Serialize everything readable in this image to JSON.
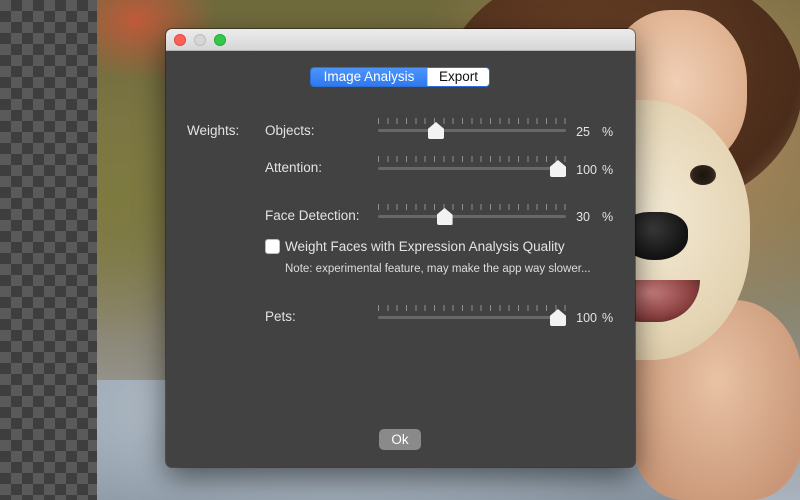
{
  "window": {
    "tabs": [
      {
        "label": "Image Analysis",
        "active": true
      },
      {
        "label": "Export",
        "active": false
      }
    ],
    "weights_label": "Weights:",
    "sliders": {
      "objects": {
        "label": "Objects:",
        "value": "25",
        "unit": "%",
        "level": 0.25
      },
      "attention": {
        "label": "Attention:",
        "value": "100",
        "unit": "%",
        "level": 1.0
      },
      "face_detection": {
        "label": "Face Detection:",
        "value": "30",
        "unit": "%",
        "level": 0.3
      },
      "pets": {
        "label": "Pets:",
        "value": "100",
        "unit": "%",
        "level": 1.0
      }
    },
    "checkbox": {
      "label": "Weight Faces with Expression Analysis Quality",
      "checked": false
    },
    "note": "Note: experimental feature, may make the app way slower...",
    "ok_label": "Ok"
  },
  "colors": {
    "window_bg": "#424242",
    "accent": "#2f79f0",
    "close": "#fc5f57",
    "maximize": "#34c84a"
  }
}
